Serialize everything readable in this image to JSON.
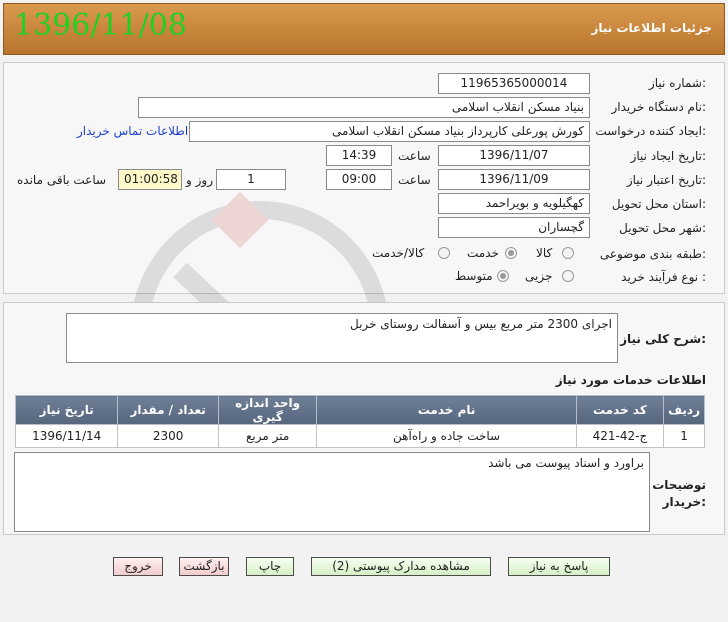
{
  "header": {
    "date": "1396/11/08",
    "title": "جزئیات اطلاعات نیاز"
  },
  "form": {
    "need_number": {
      "label": "شماره نیاز:",
      "value": "11965365000014"
    },
    "buyer_org": {
      "label": "نام دستگاه خریدار:",
      "value": "بنیاد مسکن انقلاب اسلامی"
    },
    "requester": {
      "label": "ایجاد کننده درخواست:",
      "value": "کورش پورعلی کارپرداز بنیاد مسکن انقلاب اسلامی",
      "contact_link": "اطلاعات تماس خریدار"
    },
    "created": {
      "label": "تاریخ ایجاد نیاز:",
      "date": "1396/11/07",
      "time_label": "ساعت",
      "time": "14:39"
    },
    "valid": {
      "label": "تاریخ اعتبار نیاز:",
      "date": "1396/11/09",
      "time_label": "ساعت",
      "time": "09:00",
      "days": "1",
      "days_label": "روز و",
      "remaining": "01:00:58",
      "remaining_label": "ساعت باقی مانده"
    },
    "province": {
      "label": "استان محل تحویل:",
      "value": "کهگیلویه و بویراحمد"
    },
    "city": {
      "label": "شهر محل تحویل:",
      "value": "گچساران"
    },
    "category": {
      "label": "طبقه بندی موضوعی:",
      "options": [
        "کالا",
        "خدمت",
        "کالا/خدمت"
      ],
      "selected": "خدمت"
    },
    "purchase": {
      "label": "نوع فرآیند خرید :",
      "options": [
        "جزیی",
        "متوسط"
      ],
      "selected": "متوسط"
    }
  },
  "summary": {
    "label": "شرح کلی نیاز:",
    "text": "اجرای 2300 متر مربع بیس و آسفالت روستای خربل"
  },
  "services": {
    "title": "اطلاعات خدمات مورد نیاز",
    "columns": [
      "ردیف",
      "کد خدمت",
      "نام خدمت",
      "واحد اندازه گیری",
      "تعداد / مقدار",
      "تاریخ نیاز"
    ],
    "rows": [
      [
        "1",
        "ج-42-421",
        "ساخت جاده و راه‌آهن",
        "متر مربع",
        "2300",
        "1396/11/14"
      ]
    ]
  },
  "buyer_notes": {
    "label_line1": "توضیحات",
    "label_line2": "خریدار:",
    "text": "براورد و اسناد پیوست می باشد"
  },
  "buttons": {
    "reply": "پاسخ به نیاز",
    "view_docs": "مشاهده مدارک پیوستی (2)",
    "print": "چاپ",
    "back": "بازگشت",
    "exit": "خروج"
  },
  "colors": {
    "header_bg": "#c98a40",
    "header_date": "#22d022",
    "table_header": "#5e6e86",
    "link": "#1a3fcc"
  }
}
